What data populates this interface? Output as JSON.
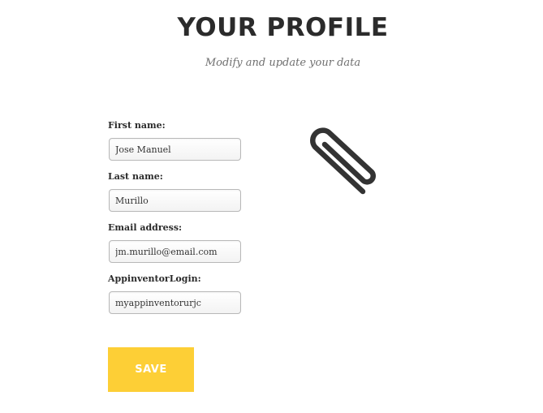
{
  "header": {
    "title": "YOUR PROFILE",
    "subtitle": "Modify and update your data"
  },
  "form": {
    "first_name": {
      "label": "First name:",
      "value": "Jose Manuel"
    },
    "last_name": {
      "label": "Last name:",
      "value": "Murillo"
    },
    "email": {
      "label": "Email address:",
      "value": "jm.murillo@email.com"
    },
    "appinventor_login": {
      "label": "AppinventorLogin:",
      "value": "myappinventorurjc"
    },
    "save_label": "SAVE"
  },
  "decoration": {
    "icon": "paperclip-icon"
  },
  "colors": {
    "accent": "#fdcf36",
    "title": "#2b2b2b",
    "subtitle": "#6f6f6f"
  }
}
